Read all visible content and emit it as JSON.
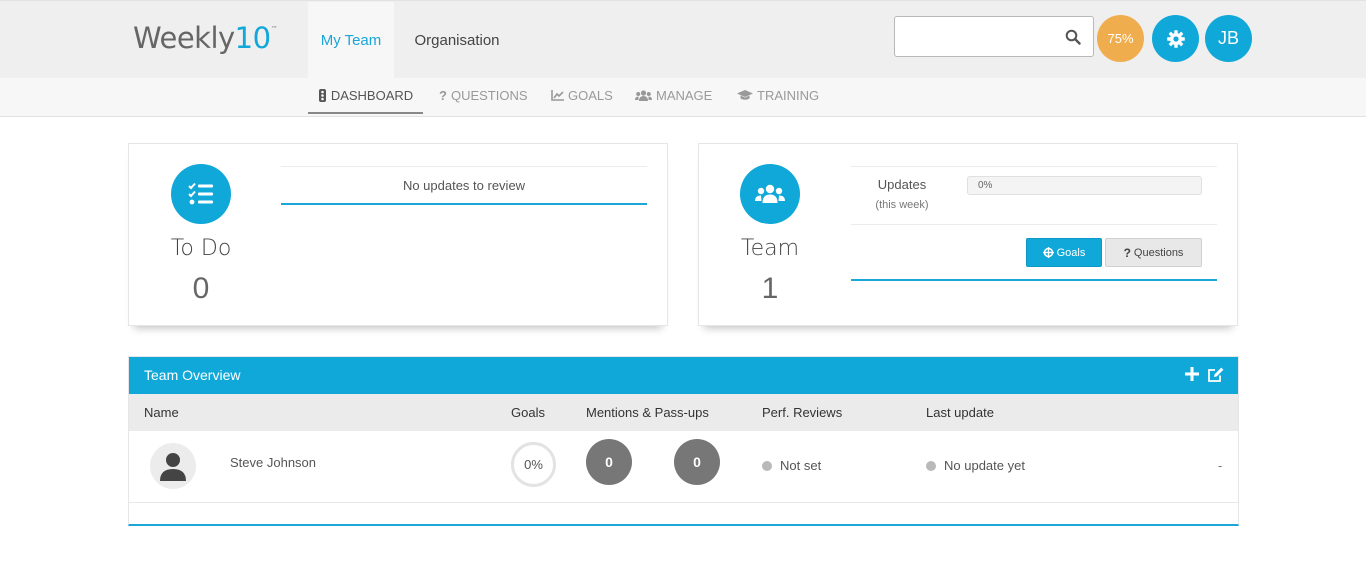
{
  "app": {
    "logo_main": "Weekly",
    "logo_num": "10",
    "logo_tm": "™"
  },
  "topnav": {
    "my_team": "My Team",
    "organisation": "Organisation"
  },
  "search": {
    "value": "",
    "placeholder": ""
  },
  "header_buttons": {
    "progress_label": "75%",
    "avatar_initials": "JB"
  },
  "subnav": {
    "dashboard": "DASHBOARD",
    "questions": "QUESTIONS",
    "goals": "GOALS",
    "manage": "MANAGE",
    "training": "TRAINING"
  },
  "todo_card": {
    "title": "To Do",
    "count": "0",
    "message": "No updates to review"
  },
  "team_card": {
    "title": "Team",
    "count": "1",
    "updates_label": "Updates",
    "updates_sub": "(this week)",
    "updates_progress": "0%",
    "goals_button": "Goals",
    "questions_button": "Questions"
  },
  "overview": {
    "title": "Team Overview",
    "columns": {
      "name": "Name",
      "goals": "Goals",
      "mentions": "Mentions & Pass-ups",
      "reviews": "Perf. Reviews",
      "last_update": "Last update"
    },
    "rows": [
      {
        "name": "Steve Johnson",
        "goals": "0%",
        "mentions": "0",
        "passups": "0",
        "review": "Not set",
        "last_update": "No update yet",
        "extra": "-"
      }
    ]
  },
  "colors": {
    "accent": "#0fa8d8",
    "progress_badge": "#f0ad4e",
    "counter_circle": "#777777"
  }
}
